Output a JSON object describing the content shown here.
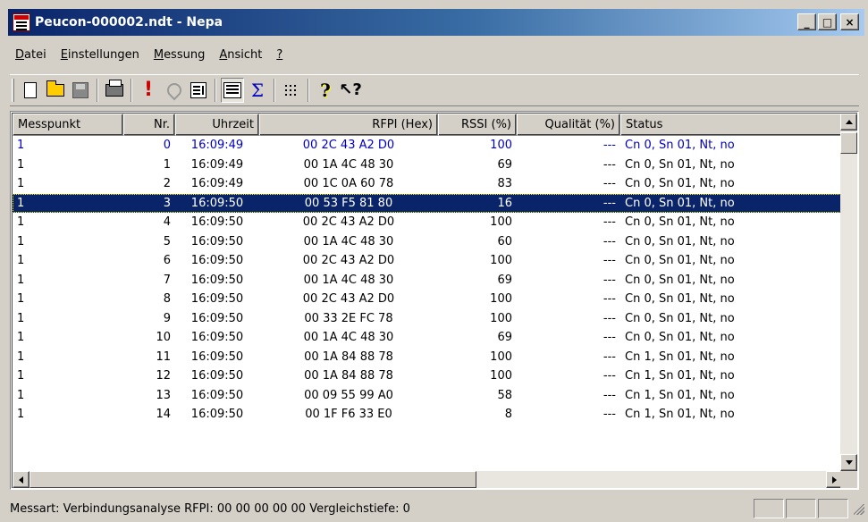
{
  "window": {
    "title": "Peucon-000002.ndt - Nepa"
  },
  "caption_buttons": {
    "minimize": "_",
    "maximize": "□",
    "close": "×"
  },
  "menu": [
    {
      "label": "Datei",
      "underline": "D"
    },
    {
      "label": "Einstellungen",
      "underline": "E"
    },
    {
      "label": "Messung",
      "underline": "M"
    },
    {
      "label": "Ansicht",
      "underline": "A"
    },
    {
      "label": "?",
      "underline": "?"
    }
  ],
  "toolbar": [
    {
      "name": "new-icon"
    },
    {
      "name": "open-folder-icon"
    },
    {
      "name": "save-disk-icon"
    },
    {
      "name": "print-icon"
    },
    {
      "name": "exclamation-icon"
    },
    {
      "name": "cut-icon"
    },
    {
      "name": "sort-list-icon"
    },
    {
      "name": "view-details-icon",
      "pressed": true
    },
    {
      "name": "sigma-icon"
    },
    {
      "name": "grid-dots-icon"
    },
    {
      "name": "help-icon"
    },
    {
      "name": "whats-this-help-icon"
    }
  ],
  "toolbar_glyphs": {
    "exclamation": "!",
    "sigma": "Σ",
    "help": "?",
    "whats_this": "↖?"
  },
  "columns": [
    {
      "label": "Messpunkt",
      "align": "left"
    },
    {
      "label": "Nr.",
      "align": "right"
    },
    {
      "label": "Uhrzeit",
      "align": "right"
    },
    {
      "label": "RFPI (Hex)",
      "align": "right"
    },
    {
      "label": "RSSI (%)",
      "align": "right"
    },
    {
      "label": "Qualität (%)",
      "align": "right"
    },
    {
      "label": "Status",
      "align": "left"
    }
  ],
  "rows": [
    [
      "1",
      "0",
      "16:09:49",
      "00 2C 43 A2 D0",
      "100",
      "---",
      "Cn 0, Sn 01, Nt, no"
    ],
    [
      "1",
      "1",
      "16:09:49",
      "00 1A 4C 48 30",
      "69",
      "---",
      "Cn 0, Sn 01, Nt, no"
    ],
    [
      "1",
      "2",
      "16:09:49",
      "00 1C 0A 60 78",
      "83",
      "---",
      "Cn 0, Sn 01, Nt, no"
    ],
    [
      "1",
      "3",
      "16:09:50",
      "00 53 F5 81 80",
      "16",
      "---",
      "Cn 0, Sn 01, Nt, no"
    ],
    [
      "1",
      "4",
      "16:09:50",
      "00 2C 43 A2 D0",
      "100",
      "---",
      "Cn 0, Sn 01, Nt, no"
    ],
    [
      "1",
      "5",
      "16:09:50",
      "00 1A 4C 48 30",
      "60",
      "---",
      "Cn 0, Sn 01, Nt, no"
    ],
    [
      "1",
      "6",
      "16:09:50",
      "00 2C 43 A2 D0",
      "100",
      "---",
      "Cn 0, Sn 01, Nt, no"
    ],
    [
      "1",
      "7",
      "16:09:50",
      "00 1A 4C 48 30",
      "69",
      "---",
      "Cn 0, Sn 01, Nt, no"
    ],
    [
      "1",
      "8",
      "16:09:50",
      "00 2C 43 A2 D0",
      "100",
      "---",
      "Cn 0, Sn 01, Nt, no"
    ],
    [
      "1",
      "9",
      "16:09:50",
      "00 33 2E FC 78",
      "100",
      "---",
      "Cn 0, Sn 01, Nt, no"
    ],
    [
      "1",
      "10",
      "16:09:50",
      "00 1A 4C 48 30",
      "69",
      "---",
      "Cn 0, Sn 01, Nt, no"
    ],
    [
      "1",
      "11",
      "16:09:50",
      "00 1A 84 88 78",
      "100",
      "---",
      "Cn 1, Sn 01, Nt, no"
    ],
    [
      "1",
      "12",
      "16:09:50",
      "00 1A 84 88 78",
      "100",
      "---",
      "Cn 1, Sn 01, Nt, no"
    ],
    [
      "1",
      "13",
      "16:09:50",
      "00 09 55 99 A0",
      "58",
      "---",
      "Cn 1, Sn 01, Nt, no"
    ],
    [
      "1",
      "14",
      "16:09:50",
      "00 1F F6 33 E0",
      "8",
      "---",
      "Cn 1, Sn 01, Nt, no"
    ]
  ],
  "selected_row": 3,
  "highlight_row": 0,
  "status": {
    "text": "Messart: Verbindungsanalyse  RFPI: 00 00 00 00 00  Vergleichstiefe: 0"
  },
  "colors": {
    "selection": "#0a246a",
    "first_row_text": "#0000c0",
    "title_gradient_start": "#0a246a",
    "title_gradient_end": "#a6caf0"
  }
}
